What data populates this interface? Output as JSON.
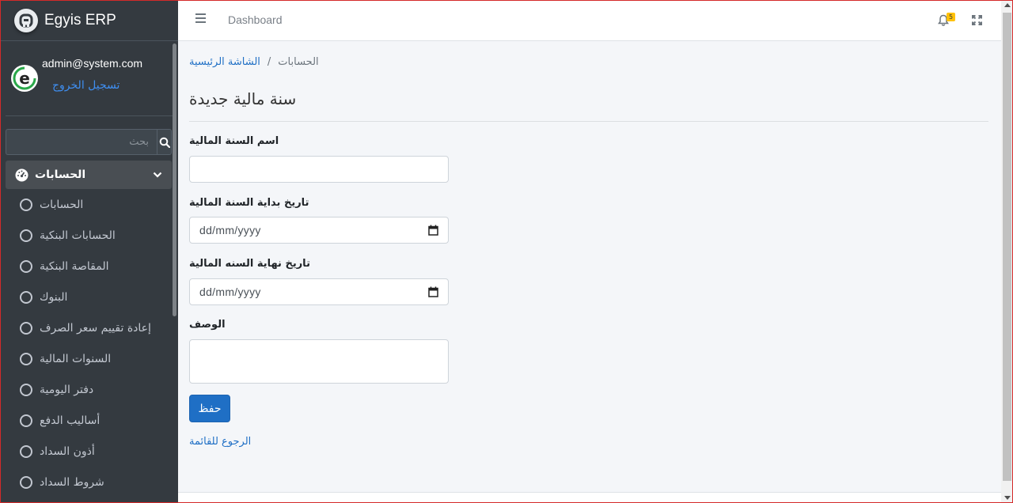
{
  "brand": {
    "name": "Egyis ERP"
  },
  "user": {
    "email": "admin@system.com",
    "logout_label": "تسجيل الخروج"
  },
  "search": {
    "placeholder": "بحث"
  },
  "nav": {
    "parent_label": "الحسابات",
    "items": [
      {
        "label": "الحسابات"
      },
      {
        "label": "الحسابات البنكية"
      },
      {
        "label": "المقاصة البنكية"
      },
      {
        "label": "البنوك"
      },
      {
        "label": "إعادة تقييم سعر الصرف"
      },
      {
        "label": "السنوات المالية"
      },
      {
        "label": "دفتر اليومية"
      },
      {
        "label": "أساليب الدفع"
      },
      {
        "label": "أذون السداد"
      },
      {
        "label": "شروط السداد"
      }
    ]
  },
  "topbar": {
    "dashboard_label": "Dashboard",
    "notification_count": "5"
  },
  "breadcrumb": {
    "home": "الشاشة الرئيسية",
    "separator": "/",
    "current": "الحسابات"
  },
  "page": {
    "title": "سنة مالية جديدة"
  },
  "form": {
    "name_label": "اسم السنة المالية",
    "name_value": "",
    "start_label": "تاريخ بداية السنة المالية",
    "start_placeholder": "dd/mm/yyyy",
    "end_label": "تاريخ نهاية السنه المالية",
    "end_placeholder": "dd/mm/yyyy",
    "description_label": "الوصف",
    "description_value": "",
    "save_label": "حفظ",
    "back_label": "الرجوع للقائمة"
  },
  "colors": {
    "sidebar": "#343a40",
    "primary": "#1f6fc5",
    "badge": "#ffc107",
    "link": "#3f8ef0"
  }
}
